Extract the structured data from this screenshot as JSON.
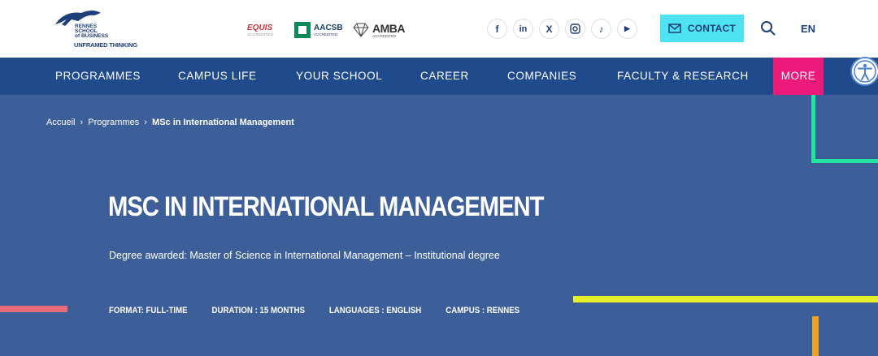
{
  "header": {
    "logo": {
      "name_lines": [
        "RENNES",
        "SCHOOL",
        "of BUSINESS"
      ],
      "tagline": "UNFRAMED THINKING",
      "icon": "running-panther-logo"
    },
    "accreditations": [
      {
        "name": "EQUIS",
        "sub": "ACCREDITED"
      },
      {
        "name": "AACSB",
        "sub": "ACCREDITED"
      },
      {
        "name": "AMBA",
        "sub": "ACCREDITED"
      }
    ],
    "social": [
      {
        "icon": "facebook-icon",
        "glyph": "f"
      },
      {
        "icon": "linkedin-icon",
        "glyph": "in"
      },
      {
        "icon": "x-twitter-icon",
        "glyph": "X"
      },
      {
        "icon": "instagram-icon",
        "glyph": ""
      },
      {
        "icon": "tiktok-icon",
        "glyph": "♪"
      },
      {
        "icon": "youtube-icon",
        "glyph": "▶"
      }
    ],
    "contact_label": "CONTACT",
    "language": "EN"
  },
  "nav": {
    "items": [
      "PROGRAMMES",
      "CAMPUS LIFE",
      "YOUR SCHOOL",
      "CAREER",
      "COMPANIES",
      "FACULTY & RESEARCH"
    ],
    "more_label": "MORE"
  },
  "breadcrumb": {
    "items": [
      "Accueil",
      "Programmes"
    ],
    "current": "MSc in International Management",
    "separator": "›"
  },
  "hero": {
    "title": "MSC IN INTERNATIONAL MANAGEMENT",
    "degree": "Degree awarded: Master of Science in International Management – Institutional degree",
    "facts": [
      "FORMAT: FULL-TIME",
      "DURATION : 15 MONTHS",
      "LANGUAGES : ENGLISH",
      "CAMPUS : RENNES"
    ]
  },
  "colors": {
    "primary": "#1f4a8c",
    "hero_bg": "#3d5f99",
    "contact_bg": "#4de3f0",
    "more_bg": "#ec1a7a",
    "accent_green": "#22e5a0",
    "accent_yellow": "#e8ef2a",
    "accent_pink": "#e86a7a",
    "accent_orange": "#f0a020"
  }
}
